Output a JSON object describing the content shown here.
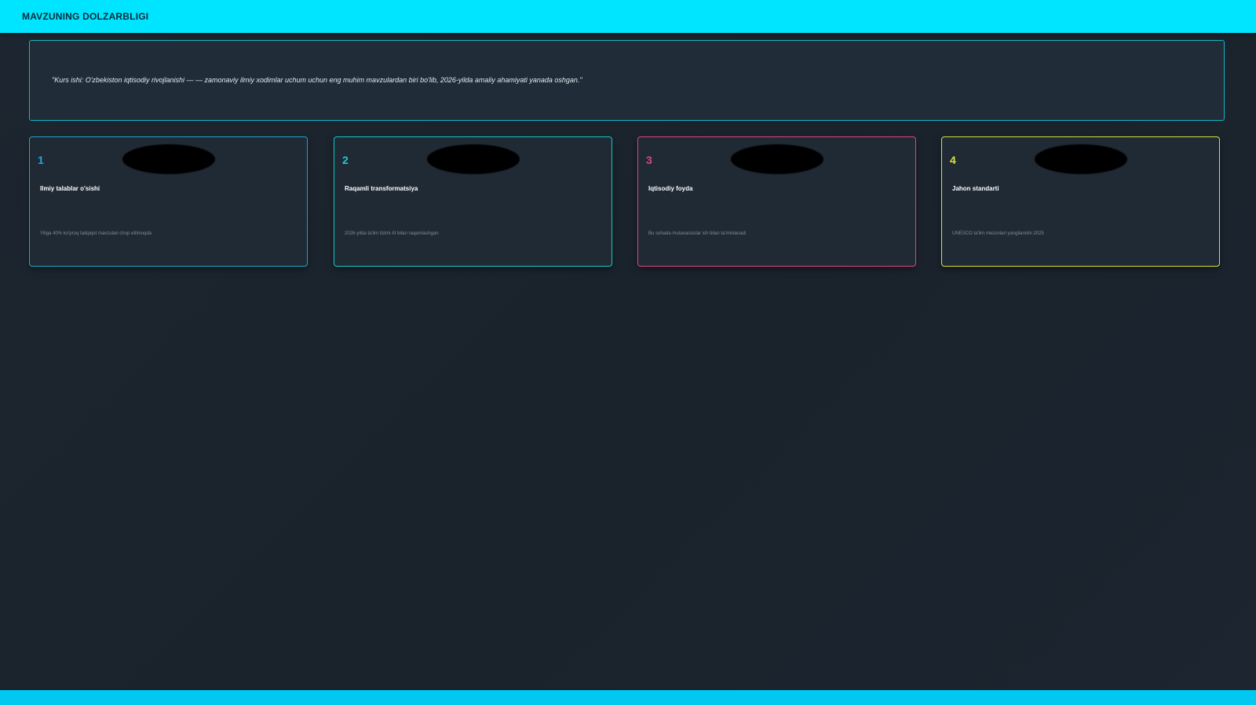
{
  "header": {
    "title": "MAVZUNING DOLZARBLIGI"
  },
  "quote": {
    "text": "\"Kurs ishi: O'zbekiston iqtisodiy rivojlanishi — — zamonaviy ilmiy xodimlar uchum uchun eng muhim mavzulardan biri bo'lib, 2026-yilda amaliy ahamiyati yanada oshgan.\""
  },
  "cards": [
    {
      "number": "1",
      "title": "Ilmiy talablar o'sishi",
      "description": "Yiliga 40% ko'proq tadqiqot mavzulari chop etilmoqda",
      "accent": "#1aa6c8"
    },
    {
      "number": "2",
      "title": "Raqamli transformatsiya",
      "description": "2026-yilda ta'lim tizimi AI bilan raqamlashgan",
      "accent": "#16c8c9"
    },
    {
      "number": "3",
      "title": "Iqtisodiy foyda",
      "description": "Bu sohada mutaxassislar ish bilan ta'minlanadi",
      "accent": "#e0457e"
    },
    {
      "number": "4",
      "title": "Jahon standarti",
      "description": "UNESCO ta'lim mezonlari yangilanishi 2025",
      "accent": "#d9e23a"
    }
  ],
  "colors": {
    "header_bg": "#00e5ff",
    "page_bg": "#1b232c",
    "footer_bg": "#00c8f0"
  }
}
